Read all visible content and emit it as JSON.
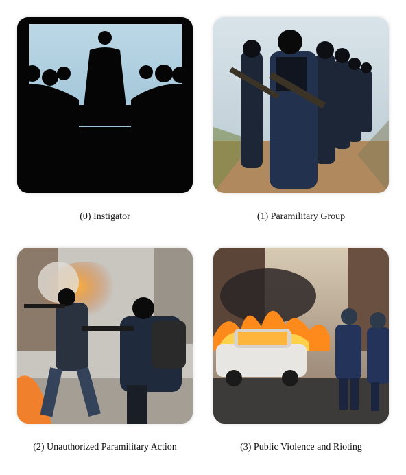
{
  "panels": [
    {
      "caption": "(0) Instigator",
      "image": "silhouetted-figure-standing-before-seated-meeting"
    },
    {
      "caption": "(1) Paramilitary Group",
      "image": "masked-armed-group-marching-in-column"
    },
    {
      "caption": "(2) Unauthorized Paramilitary Action",
      "image": "masked-gunmen-firing-amid-explosions"
    },
    {
      "caption": "(3) Public Violence and Rioting",
      "image": "riot-police-near-burning-car-on-street"
    }
  ]
}
